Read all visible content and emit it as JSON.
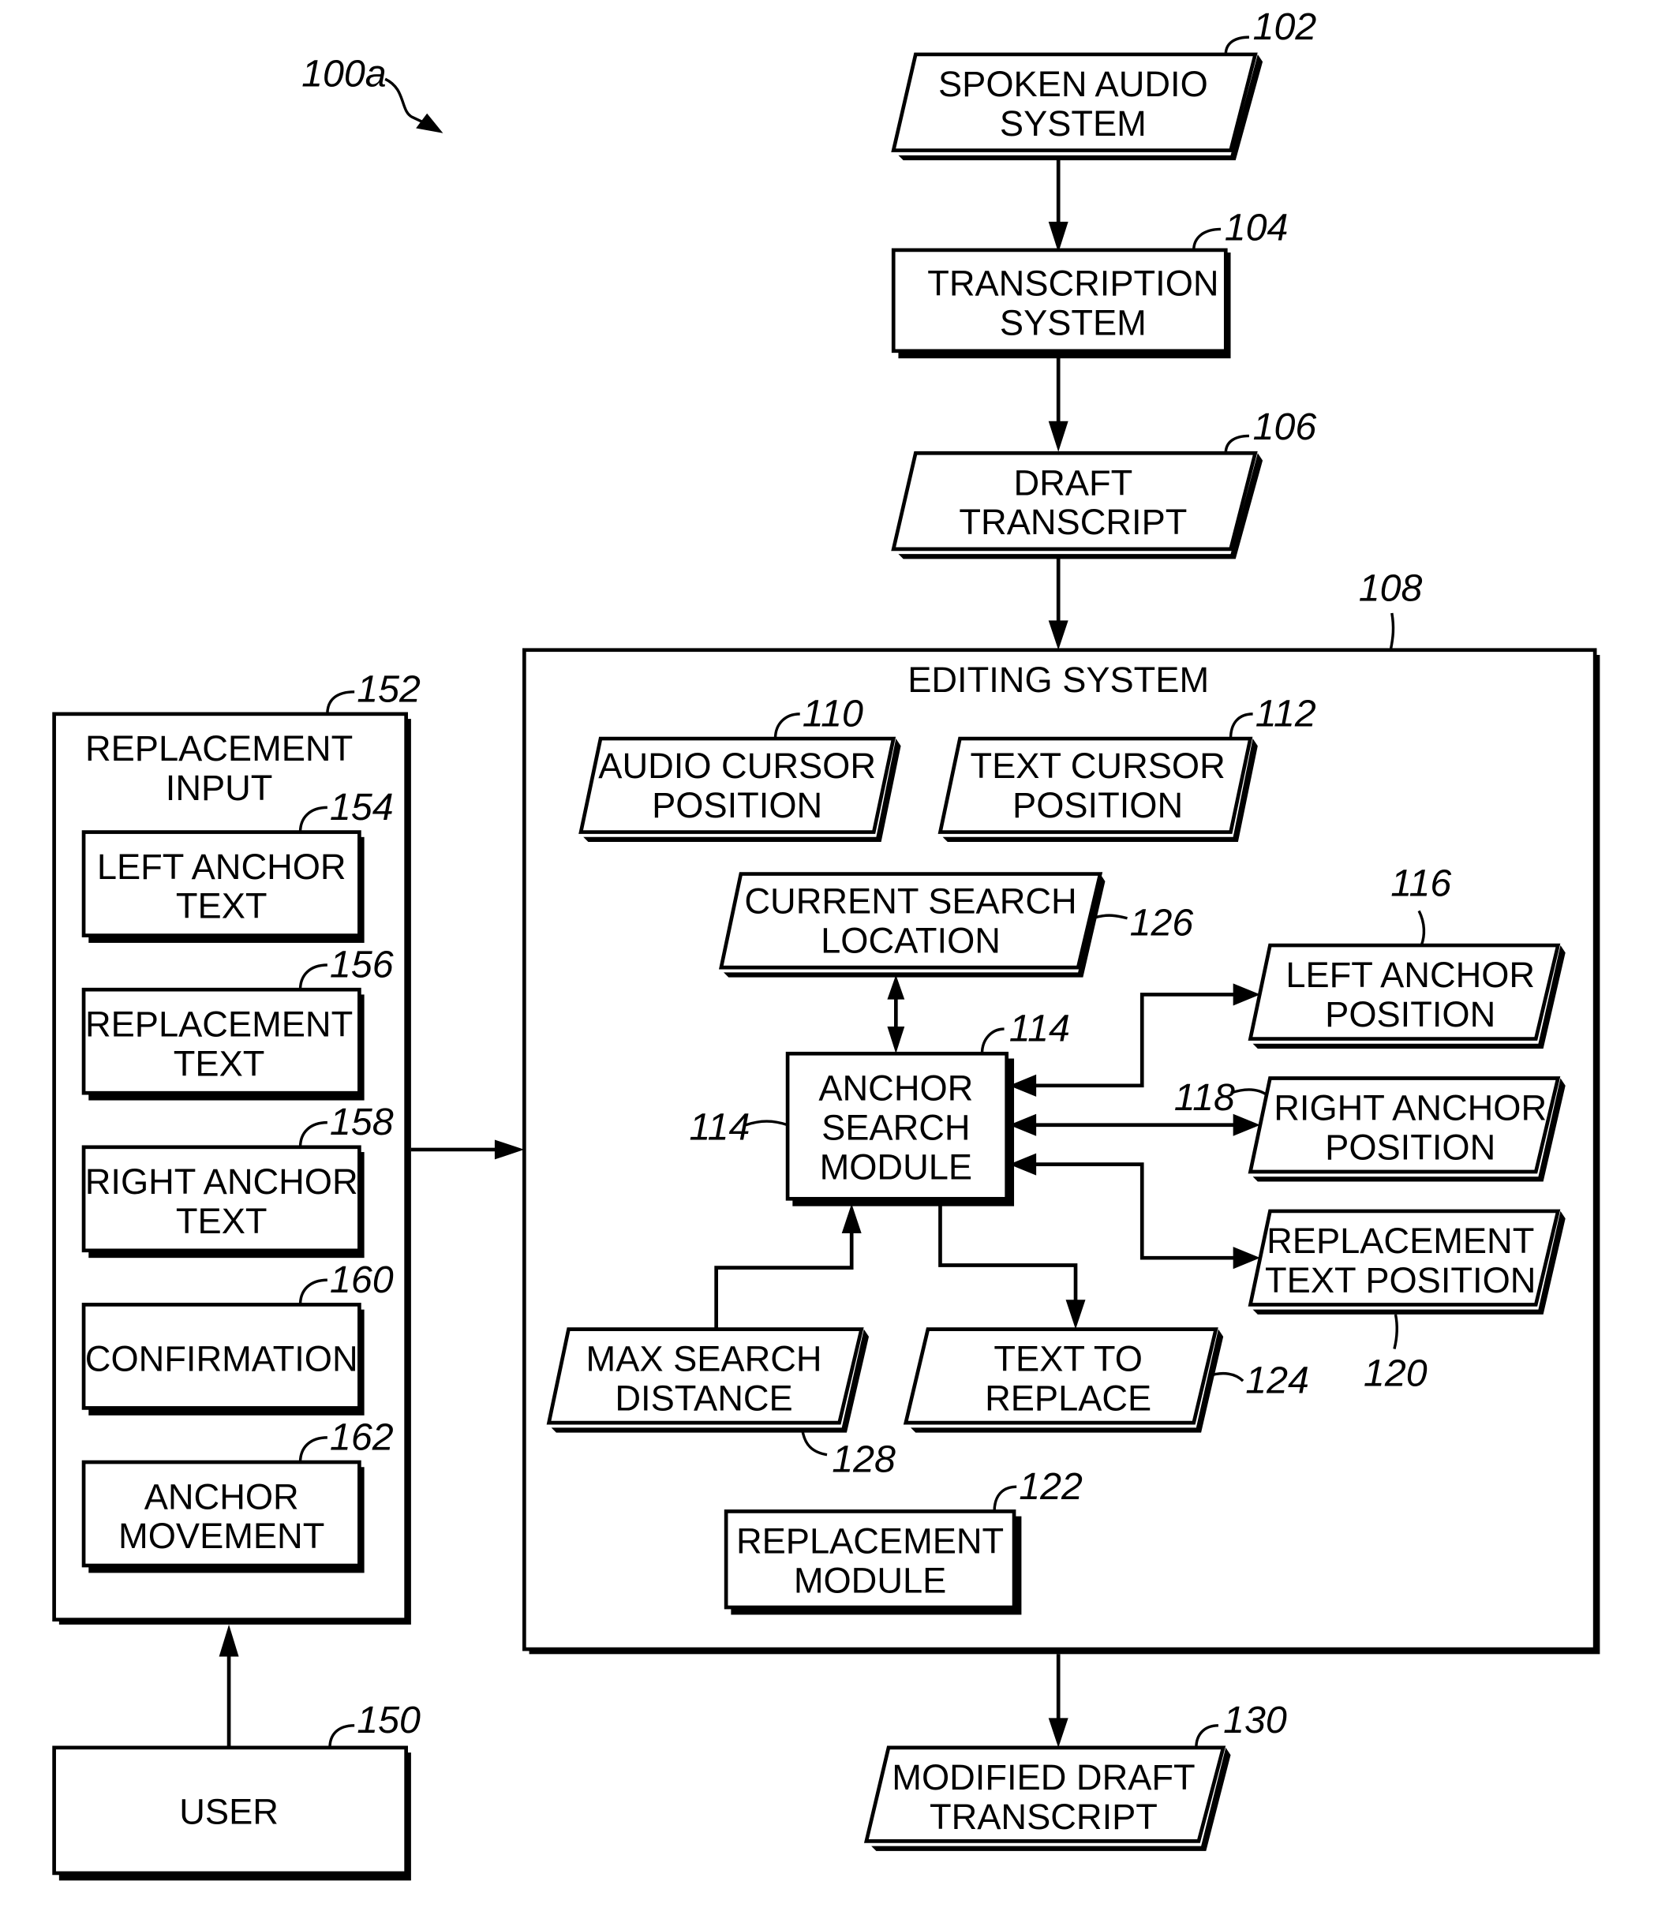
{
  "figure": {
    "label": "100a",
    "ink_color": "#000000",
    "background_color": "#ffffff"
  },
  "nodes": {
    "spoken_audio": {
      "ref": "102",
      "lines": [
        "SPOKEN AUDIO",
        "SYSTEM"
      ],
      "shape": "parallelogram"
    },
    "transcription": {
      "ref": "104",
      "lines": [
        "TRANSCRIPTION",
        "SYSTEM"
      ],
      "shape": "rectangle"
    },
    "draft_transcript": {
      "ref": "106",
      "lines": [
        "DRAFT",
        "TRANSCRIPT"
      ],
      "shape": "parallelogram"
    },
    "editing_system": {
      "ref": "108",
      "title": "EDITING SYSTEM",
      "shape": "rectangle"
    },
    "audio_cursor": {
      "ref": "110",
      "lines": [
        "AUDIO CURSOR",
        "POSITION"
      ],
      "shape": "parallelogram"
    },
    "text_cursor": {
      "ref": "112",
      "lines": [
        "TEXT CURSOR",
        "POSITION"
      ],
      "shape": "parallelogram"
    },
    "anchor_search": {
      "ref": "114",
      "ref_alt": "114",
      "lines": [
        "ANCHOR",
        "SEARCH",
        "MODULE"
      ],
      "shape": "rectangle"
    },
    "left_anchor_pos": {
      "ref": "116",
      "lines": [
        "LEFT ANCHOR",
        "POSITION"
      ],
      "shape": "parallelogram"
    },
    "right_anchor_pos": {
      "ref": "118",
      "lines": [
        "RIGHT ANCHOR",
        "POSITION"
      ],
      "shape": "parallelogram"
    },
    "replacement_text_pos": {
      "ref": "120",
      "lines": [
        "REPLACEMENT",
        "TEXT POSITION"
      ],
      "shape": "parallelogram"
    },
    "replacement_module": {
      "ref": "122",
      "lines": [
        "REPLACEMENT",
        "MODULE"
      ],
      "shape": "rectangle"
    },
    "text_to_replace": {
      "ref": "124",
      "lines": [
        "TEXT TO",
        "REPLACE"
      ],
      "shape": "parallelogram"
    },
    "current_search": {
      "ref": "126",
      "lines": [
        "CURRENT SEARCH",
        "LOCATION"
      ],
      "shape": "parallelogram"
    },
    "max_search": {
      "ref": "128",
      "lines": [
        "MAX SEARCH",
        "DISTANCE"
      ],
      "shape": "parallelogram"
    },
    "modified_draft": {
      "ref": "130",
      "lines": [
        "MODIFIED DRAFT",
        "TRANSCRIPT"
      ],
      "shape": "parallelogram"
    },
    "user": {
      "ref": "150",
      "lines": [
        "USER"
      ],
      "shape": "rectangle"
    },
    "replacement_input": {
      "ref": "152",
      "lines": [
        "REPLACEMENT",
        "INPUT"
      ],
      "shape": "rectangle"
    },
    "left_anchor_text": {
      "ref": "154",
      "lines": [
        "LEFT ANCHOR",
        "TEXT"
      ],
      "shape": "rectangle"
    },
    "replacement_text": {
      "ref": "156",
      "lines": [
        "REPLACEMENT",
        "TEXT"
      ],
      "shape": "rectangle"
    },
    "right_anchor_text": {
      "ref": "158",
      "lines": [
        "RIGHT ANCHOR",
        "TEXT"
      ],
      "shape": "rectangle"
    },
    "confirmation": {
      "ref": "160",
      "lines": [
        "CONFIRMATION"
      ],
      "shape": "rectangle"
    },
    "anchor_movement": {
      "ref": "162",
      "lines": [
        "ANCHOR",
        "MOVEMENT"
      ],
      "shape": "rectangle"
    }
  },
  "edges": [
    {
      "from": "spoken_audio",
      "to": "transcription",
      "direction": "forward"
    },
    {
      "from": "transcription",
      "to": "draft_transcript",
      "direction": "forward"
    },
    {
      "from": "draft_transcript",
      "to": "editing_system",
      "direction": "forward"
    },
    {
      "from": "editing_system",
      "to": "modified_draft",
      "direction": "forward"
    },
    {
      "from": "user",
      "to": "replacement_input",
      "direction": "forward"
    },
    {
      "from": "replacement_input",
      "to": "editing_system",
      "direction": "forward"
    },
    {
      "from": "current_search",
      "to": "anchor_search",
      "direction": "bidirectional"
    },
    {
      "from": "left_anchor_pos",
      "to": "anchor_search",
      "direction": "bidirectional"
    },
    {
      "from": "right_anchor_pos",
      "to": "anchor_search",
      "direction": "bidirectional"
    },
    {
      "from": "replacement_text_pos",
      "to": "anchor_search",
      "direction": "bidirectional"
    },
    {
      "from": "max_search",
      "to": "anchor_search",
      "direction": "forward"
    },
    {
      "from": "anchor_search",
      "to": "text_to_replace",
      "direction": "forward"
    }
  ]
}
